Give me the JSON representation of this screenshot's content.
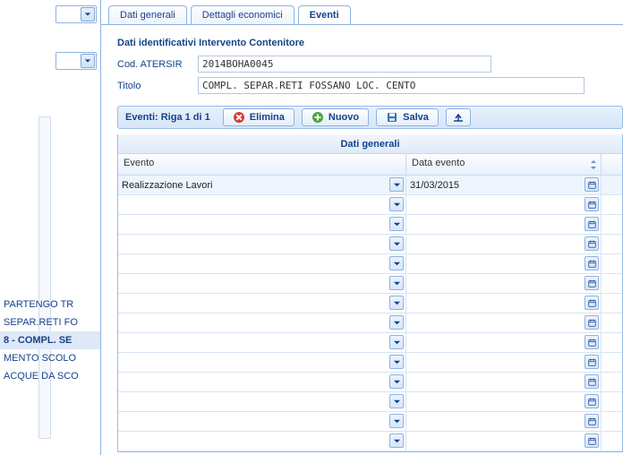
{
  "left_list": [
    {
      "label": "PARTENGO TR",
      "selected": false
    },
    {
      "label": "SEPAR.RETI FO",
      "selected": false
    },
    {
      "label": "8 - COMPL. SE",
      "selected": true
    },
    {
      "label": "MENTO SCOLO",
      "selected": false
    },
    {
      "label": "ACQUE DA SCO",
      "selected": false
    }
  ],
  "tabs": [
    {
      "label": "Dati generali",
      "active": false
    },
    {
      "label": "Dettagli economici",
      "active": false
    },
    {
      "label": "Eventi",
      "active": true
    }
  ],
  "section": "Dati identificativi Intervento Contenitore",
  "form": {
    "cod_label": "Cod. ATERSIR",
    "cod_value": "2014BOHA0045",
    "titolo_label": "Titolo",
    "titolo_value": "COMPL. SEPAR.RETI FOSSANO LOC. CENTO"
  },
  "toolbar": {
    "info": "Eventi: Riga 1 di 1",
    "delete": "Elimina",
    "new": "Nuovo",
    "save": "Salva"
  },
  "grid": {
    "header": "Dati generali",
    "col1": "Evento",
    "col2": "Data evento",
    "rows": [
      {
        "evento": "Realizzazione Lavori",
        "data": "31/03/2015"
      },
      {
        "evento": "",
        "data": ""
      },
      {
        "evento": "",
        "data": ""
      },
      {
        "evento": "",
        "data": ""
      },
      {
        "evento": "",
        "data": ""
      },
      {
        "evento": "",
        "data": ""
      },
      {
        "evento": "",
        "data": ""
      },
      {
        "evento": "",
        "data": ""
      },
      {
        "evento": "",
        "data": ""
      },
      {
        "evento": "",
        "data": ""
      },
      {
        "evento": "",
        "data": ""
      },
      {
        "evento": "",
        "data": ""
      },
      {
        "evento": "",
        "data": ""
      },
      {
        "evento": "",
        "data": ""
      }
    ]
  }
}
